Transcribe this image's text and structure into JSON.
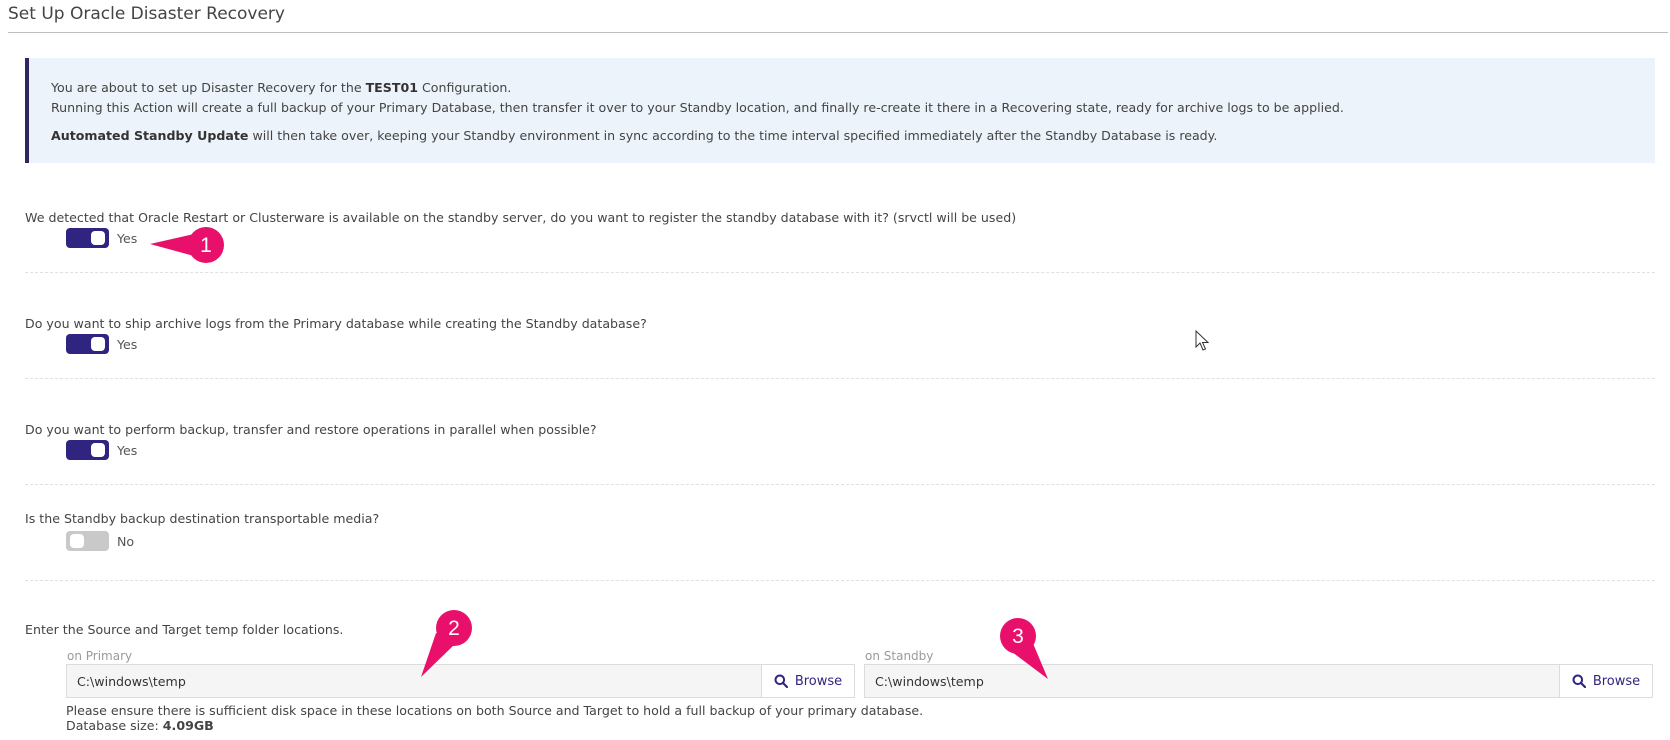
{
  "page": {
    "title": "Set Up Oracle Disaster Recovery"
  },
  "info": {
    "line1_prefix": "You are about to set up Disaster Recovery for the ",
    "config_name": "TEST01",
    "line1_suffix": " Configuration.",
    "line2": "Running this Action will create a full backup of your Primary Database, then transfer it over to your Standby location, and finally re-create it there in a Recovering state, ready for archive logs to be applied.",
    "line3_bold": "Automated Standby Update",
    "line3_rest": " will then take over, keeping your Standby environment in sync according to the time interval specified immediately after the Standby Database is ready."
  },
  "questions": [
    {
      "text": "We detected that Oracle Restart or Clusterware is available on the standby server, do you want to register the standby database with it? (srvctl will be used)",
      "state": "on",
      "label": "Yes"
    },
    {
      "text": "Do you want to ship archive logs from the Primary database while creating the Standby database?",
      "state": "on",
      "label": "Yes"
    },
    {
      "text": "Do you want to perform backup, transfer and restore operations in parallel when possible?",
      "state": "on",
      "label": "Yes"
    },
    {
      "text": "Is the Standby backup destination transportable media?",
      "state": "off",
      "label": "No"
    }
  ],
  "temp": {
    "prompt": "Enter the Source and Target temp folder locations.",
    "primary_caption": "on Primary",
    "primary_value": "C:\\windows\\temp",
    "standby_caption": "on Standby",
    "standby_value": "C:\\windows\\temp",
    "browse_label": "Browse",
    "note_line1": "Please ensure there is sufficient disk space in these locations on both Source and Target to hold a full backup of your primary database.",
    "size_prefix": "Database size: ",
    "size_value": "4.09GB"
  },
  "callouts": [
    "1",
    "2",
    "3"
  ],
  "colors": {
    "accent": "#2f2580",
    "callout": "#e8106a",
    "info_bg": "#ecf3fa"
  },
  "icons": [
    "search-icon",
    "mouse-cursor-icon"
  ]
}
